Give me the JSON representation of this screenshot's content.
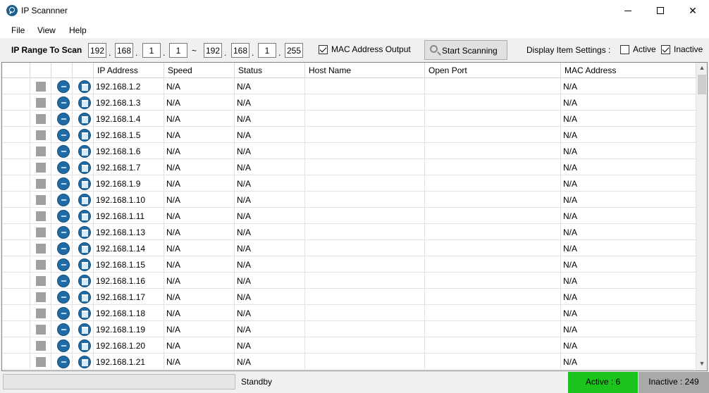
{
  "window": {
    "title": "IP Scannner"
  },
  "menu": {
    "file": "File",
    "view": "View",
    "help": "Help"
  },
  "toolbar": {
    "range_label": "IP Range To Scan",
    "start_ip": [
      "192",
      "168",
      "1",
      "1"
    ],
    "tilde": "~",
    "end_ip": [
      "192",
      "168",
      "1",
      "255"
    ],
    "dot": ".",
    "mac_output_label": "MAC Address Output",
    "mac_output_checked": true,
    "start_scan_label": "Start Scanning",
    "display_settings_label": "Display Item Settings :",
    "active_label": "Active",
    "active_checked": false,
    "inactive_label": "Inactive",
    "inactive_checked": true
  },
  "columns": [
    "IP Address",
    "Speed",
    "Status",
    "Host Name",
    "Open Port",
    "MAC Address"
  ],
  "rows": [
    {
      "ip": "192.168.1.2",
      "speed": "N/A",
      "status": "N/A",
      "host": "",
      "port": "",
      "mac": "N/A"
    },
    {
      "ip": "192.168.1.3",
      "speed": "N/A",
      "status": "N/A",
      "host": "",
      "port": "",
      "mac": "N/A"
    },
    {
      "ip": "192.168.1.4",
      "speed": "N/A",
      "status": "N/A",
      "host": "",
      "port": "",
      "mac": "N/A"
    },
    {
      "ip": "192.168.1.5",
      "speed": "N/A",
      "status": "N/A",
      "host": "",
      "port": "",
      "mac": "N/A"
    },
    {
      "ip": "192.168.1.6",
      "speed": "N/A",
      "status": "N/A",
      "host": "",
      "port": "",
      "mac": "N/A"
    },
    {
      "ip": "192.168.1.7",
      "speed": "N/A",
      "status": "N/A",
      "host": "",
      "port": "",
      "mac": "N/A"
    },
    {
      "ip": "192.168.1.9",
      "speed": "N/A",
      "status": "N/A",
      "host": "",
      "port": "",
      "mac": "N/A"
    },
    {
      "ip": "192.168.1.10",
      "speed": "N/A",
      "status": "N/A",
      "host": "",
      "port": "",
      "mac": "N/A"
    },
    {
      "ip": "192.168.1.11",
      "speed": "N/A",
      "status": "N/A",
      "host": "",
      "port": "",
      "mac": "N/A"
    },
    {
      "ip": "192.168.1.13",
      "speed": "N/A",
      "status": "N/A",
      "host": "",
      "port": "",
      "mac": "N/A"
    },
    {
      "ip": "192.168.1.14",
      "speed": "N/A",
      "status": "N/A",
      "host": "",
      "port": "",
      "mac": "N/A"
    },
    {
      "ip": "192.168.1.15",
      "speed": "N/A",
      "status": "N/A",
      "host": "",
      "port": "",
      "mac": "N/A"
    },
    {
      "ip": "192.168.1.16",
      "speed": "N/A",
      "status": "N/A",
      "host": "",
      "port": "",
      "mac": "N/A"
    },
    {
      "ip": "192.168.1.17",
      "speed": "N/A",
      "status": "N/A",
      "host": "",
      "port": "",
      "mac": "N/A"
    },
    {
      "ip": "192.168.1.18",
      "speed": "N/A",
      "status": "N/A",
      "host": "",
      "port": "",
      "mac": "N/A"
    },
    {
      "ip": "192.168.1.19",
      "speed": "N/A",
      "status": "N/A",
      "host": "",
      "port": "",
      "mac": "N/A"
    },
    {
      "ip": "192.168.1.20",
      "speed": "N/A",
      "status": "N/A",
      "host": "",
      "port": "",
      "mac": "N/A"
    },
    {
      "ip": "192.168.1.21",
      "speed": "N/A",
      "status": "N/A",
      "host": "",
      "port": "",
      "mac": "N/A"
    }
  ],
  "status": {
    "text": "Standby",
    "progress_fraction": 0,
    "active": "Active : 6",
    "inactive": "Inactive : 249",
    "active_color": "#1bc41b",
    "inactive_color": "#a9a9a9"
  }
}
